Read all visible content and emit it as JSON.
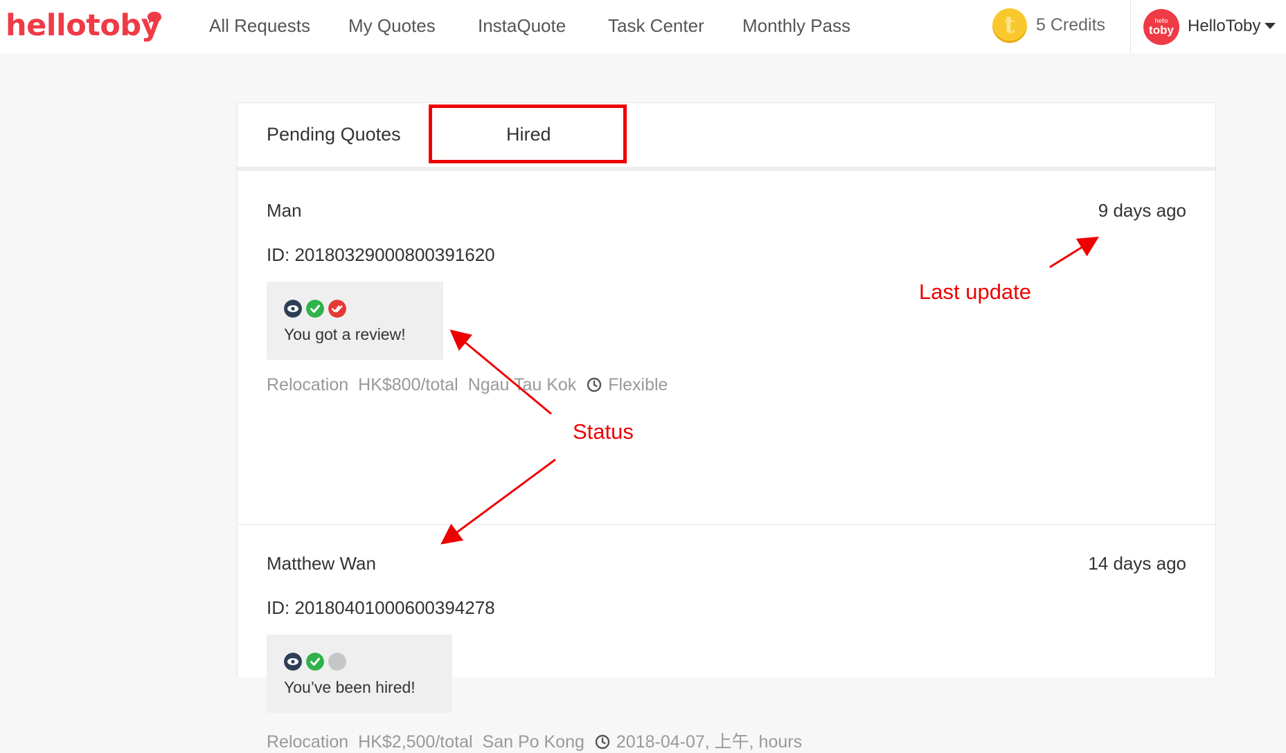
{
  "brand": {
    "name": "hellotoby",
    "accent_color": "#ef3b46"
  },
  "nav": {
    "links": [
      {
        "label": "All Requests"
      },
      {
        "label": "My Quotes"
      },
      {
        "label": "InstaQuote"
      },
      {
        "label": "Task Center"
      },
      {
        "label": "Monthly Pass"
      }
    ],
    "credits": {
      "icon": "toby-coin-icon",
      "label": "5 Credits"
    },
    "user": {
      "avatar_top": "hello",
      "avatar_bottom": "toby",
      "name": "HelloToby"
    }
  },
  "tabs": [
    {
      "label": "Pending Quotes",
      "active": false
    },
    {
      "label": "Hired",
      "active": true
    }
  ],
  "hires": [
    {
      "name": "Man",
      "updated": "9 days ago",
      "id_label": "ID: 20180329000800391620",
      "status_icons": [
        "viewed-eye-icon",
        "accepted-check-icon",
        "reviewed-double-check-icon"
      ],
      "status_text": "You got a review!",
      "category": "Relocation",
      "price": "HK$800/total",
      "location": "Ngau Tau Kok",
      "schedule": "Flexible"
    },
    {
      "name": "Matthew Wan",
      "updated": "14 days ago",
      "id_label": "ID: 20180401000600394278",
      "status_icons": [
        "viewed-eye-icon",
        "accepted-check-icon",
        "pending-grey-dot-icon"
      ],
      "status_text": "You’ve been hired!",
      "category": "Relocation",
      "price": "HK$2,500/total",
      "location": "San Po Kong",
      "schedule": "2018-04-07, 上午, hours"
    }
  ],
  "annotations": {
    "last_update": "Last update",
    "status": "Status",
    "color": "#ee0000"
  }
}
